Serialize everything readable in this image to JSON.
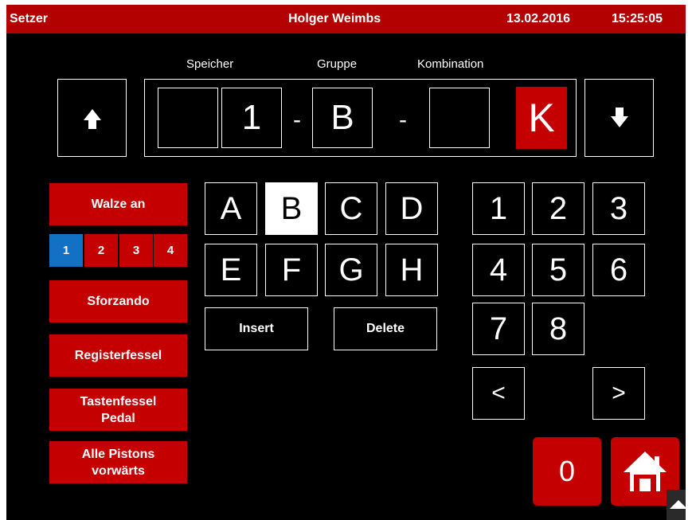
{
  "titlebar": {
    "app": "Setzer",
    "user": "Holger Weimbs",
    "date": "13.02.2016",
    "time": "15:25:05"
  },
  "labels": {
    "speicher": "Speicher",
    "gruppe": "Gruppe",
    "kombination": "Kombination"
  },
  "display": {
    "slot1": "",
    "slot2": "1",
    "dash1": "-",
    "slot3": "B",
    "dash2": "-",
    "slot4": "",
    "badge": "K"
  },
  "left_buttons": {
    "walze": "Walze an",
    "pills": [
      "1",
      "2",
      "3",
      "4"
    ],
    "active_pill": "1",
    "sforzando": "Sforzando",
    "registerfessel": "Registerfessel",
    "tastenfessel_line1": "Tastenfessel",
    "tastenfessel_line2": "Pedal",
    "pistons_line1": "Alle Pistons",
    "pistons_line2": "vorwärts"
  },
  "letters": [
    "A",
    "B",
    "C",
    "D",
    "E",
    "F",
    "G",
    "H"
  ],
  "selected_letter": "B",
  "actions": {
    "insert": "Insert",
    "delete": "Delete"
  },
  "digits": [
    "1",
    "2",
    "3",
    "4",
    "5",
    "6",
    "7",
    "8"
  ],
  "nav": {
    "prev": "<",
    "next": ">"
  },
  "bottom": {
    "zero": "0"
  },
  "colors": {
    "accent_red": "#c50000",
    "titlebar_red": "#b30000",
    "active_blue": "#1270c5",
    "background": "#000000"
  },
  "icons": {
    "up": "arrow-up-icon",
    "down": "arrow-down-icon",
    "home": "home-icon",
    "scroll": "triangle-up-icon"
  }
}
